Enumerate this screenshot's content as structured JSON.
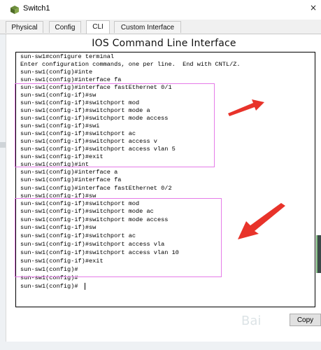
{
  "window": {
    "title": "Switch1",
    "close_glyph": "×"
  },
  "tabs": [
    {
      "label": "Physical"
    },
    {
      "label": "Config"
    },
    {
      "label": "CLI"
    },
    {
      "label": "Custom Interface"
    }
  ],
  "cli": {
    "heading": "IOS Command Line Interface",
    "lines": [
      "sun-sw1#configure terminal",
      "Enter configuration commands, one per line.  End with CNTL/Z.",
      "sun-sw1(config)#inte",
      "sun-sw1(config)#interface fa",
      "sun-sw1(config)#interface fastEthernet 0/1",
      "sun-sw1(config-if)#sw",
      "sun-sw1(config-if)#switchport mod",
      "sun-sw1(config-if)#switchport mode a",
      "sun-sw1(config-if)#switchport mode access",
      "sun-sw1(config-if)#swi",
      "sun-sw1(config-if)#switchport ac",
      "sun-sw1(config-if)#switchport access v",
      "sun-sw1(config-if)#switchport access vlan 5",
      "sun-sw1(config-if)#exit",
      "sun-sw1(config)#int",
      "sun-sw1(config)#interface a",
      "sun-sw1(config)#interface fa",
      "sun-sw1(config)#interface fastEthernet 0/2",
      "sun-sw1(config-if)#sw",
      "sun-sw1(config-if)#switchport mod",
      "sun-sw1(config-if)#switchport mode ac",
      "sun-sw1(config-if)#switchport mode access",
      "sun-sw1(config-if)#sw",
      "sun-sw1(config-if)#switchport ac",
      "sun-sw1(config-if)#switchport access vla",
      "sun-sw1(config-if)#switchport access vlan 10",
      "sun-sw1(config-if)#exit",
      "sun-sw1(config)#",
      "sun-sw1(config)#",
      "sun-sw1(config)#"
    ]
  },
  "buttons": {
    "copy": "Copy"
  },
  "icons": {
    "app": "switch-icon",
    "close": "close-icon"
  },
  "colors": {
    "highlight": "#e57be8",
    "arrow": "#e8332a"
  }
}
